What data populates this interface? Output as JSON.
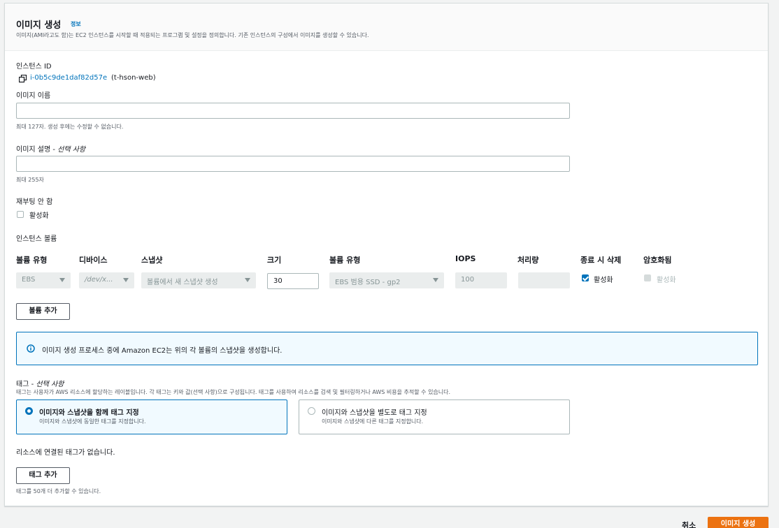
{
  "header": {
    "title": "이미지 생성",
    "info_link": "정보",
    "description": "이미지(AMI라고도 함)는 EC2 인스턴스를 시작할 때 적용되는 프로그램 및 설정을 정의합니다. 기존 인스턴스의 구성에서 이미지를 생성할 수 있습니다."
  },
  "instance": {
    "label": "인스턴스 ID",
    "id": "i-0b5c9de1daf82d57e",
    "name": "(t-hson-web)"
  },
  "image_name": {
    "label": "이미지 이름",
    "value": "",
    "hint": "최대 127자. 생성 후에는 수정할 수 없습니다."
  },
  "image_description": {
    "label": "이미지 설명 - ",
    "optional": "선택 사항",
    "value": "",
    "hint": "최대 255자"
  },
  "no_reboot": {
    "label": "재부팅 안 함",
    "checkbox_label": "활성화",
    "checked": false
  },
  "volumes": {
    "label": "인스턴스 볼륨",
    "columns": [
      "볼륨 유형",
      "디바이스",
      "스냅샷",
      "크기",
      "볼륨 유형",
      "IOPS",
      "처리량",
      "종료 시 삭제",
      "암호화됨"
    ],
    "row": {
      "volume_type": "EBS",
      "device": "/dev/x...",
      "snapshot": "볼륨에서 새 스냅샷 생성",
      "size": "30",
      "ebs_type": "EBS 범용 SSD - gp2",
      "iops": "100",
      "throughput": "",
      "delete_on_termination": "활성화",
      "delete_checked": true,
      "encrypted": "활성화",
      "encrypted_checked": false
    },
    "add_button": "볼륨 추가"
  },
  "alert": {
    "text": "이미지 생성 프로세스 중에 Amazon EC2는 위의 각 볼륨의 스냅샷을 생성합니다.",
    "accent": "#0073bb"
  },
  "tags": {
    "label": "태그 - ",
    "optional": "선택 사항",
    "description": "태그는 사용자가 AWS 리소스에 할당하는 레이블입니다. 각 태그는 키와 값(선택 사항)으로 구성됩니다. 태그를 사용하여 리소스를 검색 및 필터링하거나 AWS 비용을 추적할 수 있습니다.",
    "options": [
      {
        "title": "이미지와 스냅샷을 함께 태그 지정",
        "desc": "이미지와 스냅샷에 동일한 태그를 지정합니다.",
        "selected": true
      },
      {
        "title": "이미지와 스냅샷을 별도로 태그 지정",
        "desc": "이미지와 스냅샷에 다른 태그를 지정합니다.",
        "selected": false
      }
    ],
    "empty_text": "리소스에 연결된 태그가 없습니다.",
    "add_button": "태그 추가",
    "limit_hint": "태그를 50개 더 추가할 수 있습니다."
  },
  "footer": {
    "cancel": "취소",
    "create": "이미지 생성",
    "primary_color": "#ec7211"
  }
}
